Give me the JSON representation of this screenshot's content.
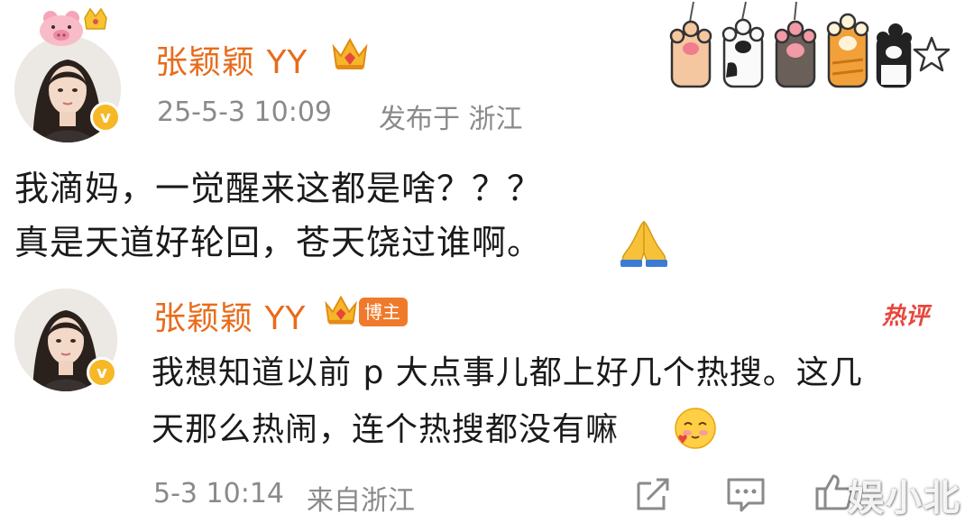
{
  "post": {
    "username": "张颖颖 YY",
    "timestamp": "25-5-3 10:09",
    "location": "发布于 浙江",
    "lines": [
      "我滴妈，一觉醒来这都是啥？？？",
      "真是天道好轮回，苍天饶过谁啊。"
    ],
    "emoji_icon": "praying-hands-icon",
    "badges": [
      "pig-crown-avatar-decoration",
      "verified-icon",
      "crown-icon"
    ],
    "decoration": [
      "cat-paw-icon",
      "cat-paw-icon",
      "cat-paw-icon",
      "cat-paw-icon",
      "cat-paw-icon",
      "star-icon"
    ]
  },
  "reply": {
    "username": "张颖颖 YY",
    "blogger_tag": "博主",
    "hot_label": "热评",
    "lines": [
      "我想知道以前 p 大点事儿都上好几个热搜。这几",
      "天那么热闹，连个热搜都没有嘛"
    ],
    "emoji_icon": "shy-face-emoji-icon",
    "timestamp": "5-3 10:14",
    "source": "来自浙江",
    "actions": [
      "share-icon",
      "comment-icon",
      "like-icon"
    ]
  },
  "watermark": "娱小北",
  "colors": {
    "username": "#e86b1b",
    "meta": "#8a8a8a",
    "verified": "#f6b826",
    "hot": "#e8463d",
    "blogger_tag": "#f07a2b"
  }
}
